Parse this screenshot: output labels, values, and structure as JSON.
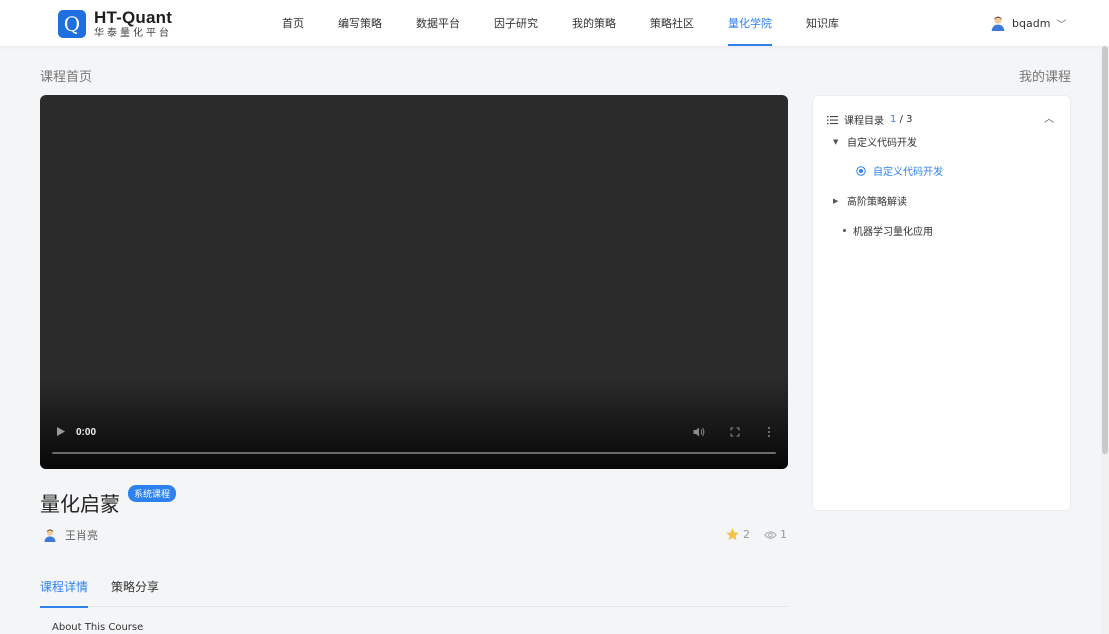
{
  "brand": {
    "mark": "Q",
    "title": "HT-Quant",
    "subtitle": "华泰量化平台"
  },
  "nav": {
    "items": [
      {
        "label": "首页"
      },
      {
        "label": "编写策略"
      },
      {
        "label": "数据平台"
      },
      {
        "label": "因子研究"
      },
      {
        "label": "我的策略"
      },
      {
        "label": "策略社区"
      },
      {
        "label": "量化学院",
        "active": true
      },
      {
        "label": "知识库"
      }
    ]
  },
  "user": {
    "name": "bqadm",
    "icon": "user-avatar-icon"
  },
  "page": {
    "title": "课程首页",
    "my_courses": "我的课程"
  },
  "video": {
    "time": "0:00"
  },
  "course": {
    "title": "量化启蒙",
    "badge": "系统课程",
    "author": "王肖亮",
    "favorites": "2",
    "views": "1"
  },
  "tabs": [
    {
      "label": "课程详情",
      "active": true
    },
    {
      "label": "策略分享"
    }
  ],
  "about": "About This Course",
  "catalog": {
    "label": "课程目录",
    "current": "1",
    "total": "/ 3",
    "items": [
      {
        "label": "自定义代码开发",
        "type": "section-open"
      },
      {
        "label": "自定义代码开发",
        "type": "lesson-active"
      },
      {
        "label": "高阶策略解读",
        "type": "section-closed"
      },
      {
        "label": "机器学习量化应用",
        "type": "bullet"
      }
    ]
  },
  "colors": {
    "accent": "#2d82f0",
    "brand": "#1f6fe0",
    "star": "#f5c242"
  }
}
